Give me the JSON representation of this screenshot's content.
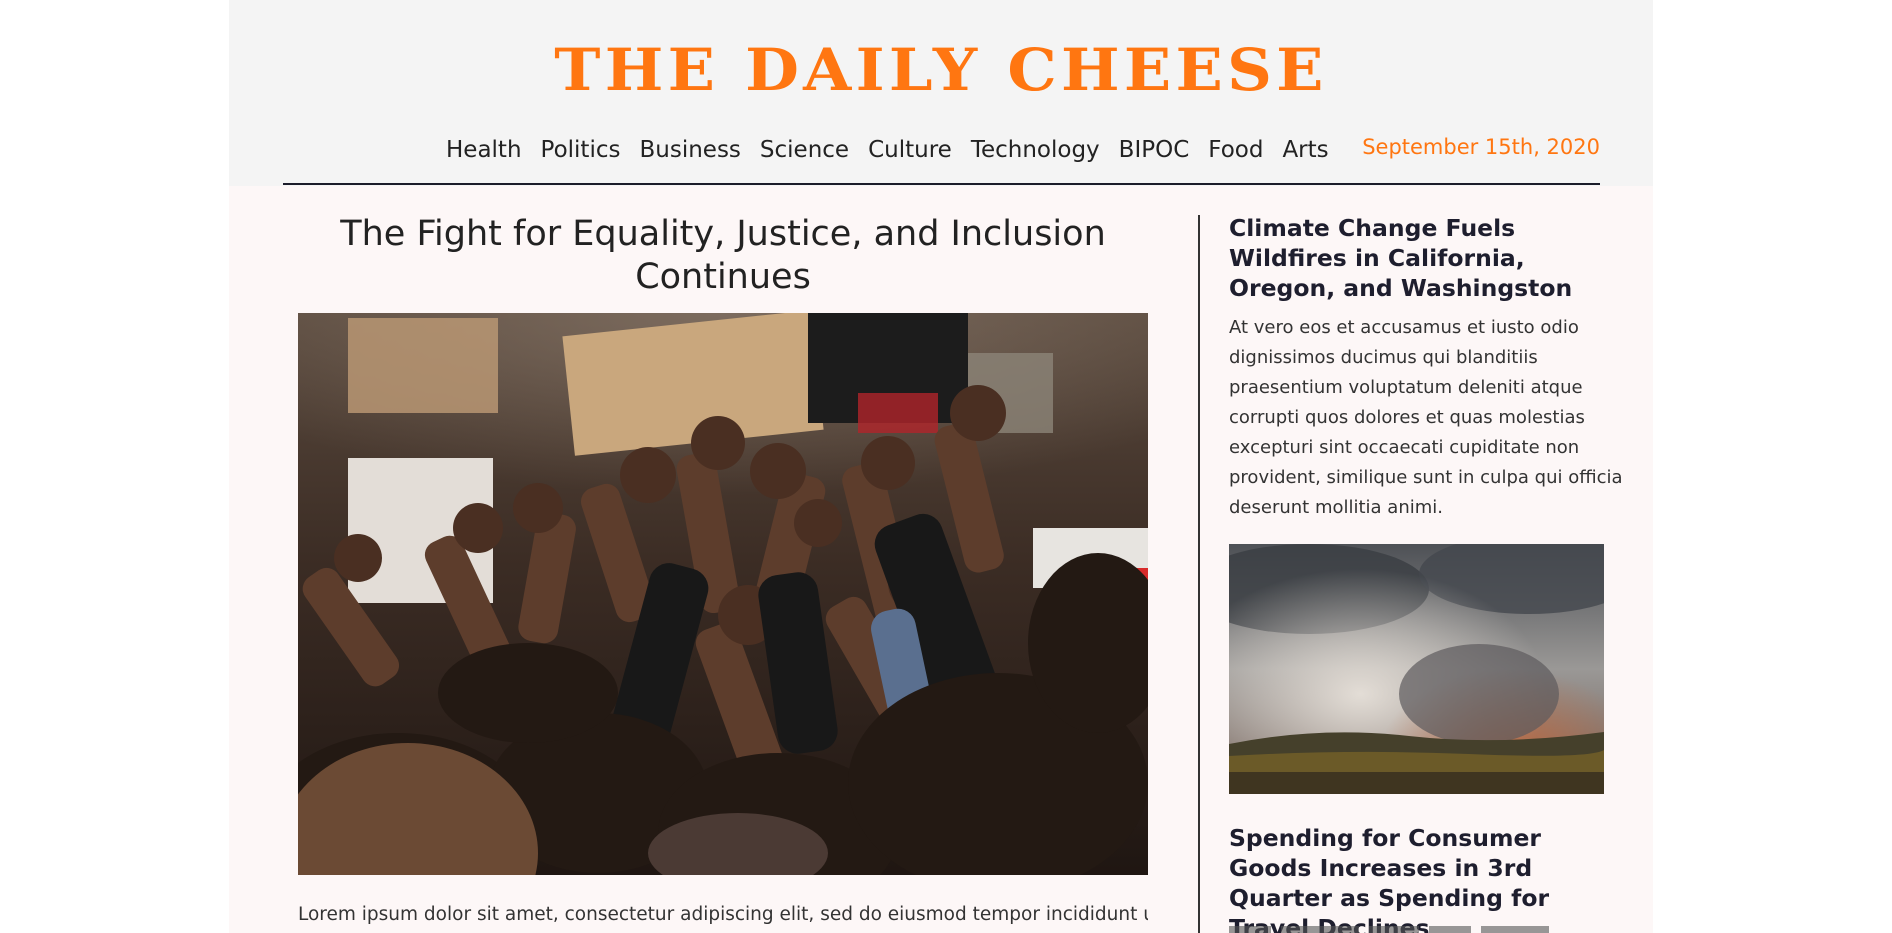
{
  "masthead": {
    "title": "THE DAILY CHEESE",
    "date": "September 15th, 2020"
  },
  "nav": {
    "items": [
      {
        "label": "Health"
      },
      {
        "label": "Politics"
      },
      {
        "label": "Business"
      },
      {
        "label": "Science"
      },
      {
        "label": "Culture"
      },
      {
        "label": "Technology"
      },
      {
        "label": "BIPOC"
      },
      {
        "label": "Food"
      },
      {
        "label": "Arts"
      }
    ]
  },
  "main_article": {
    "title": "The Fight for Equality, Justice, and Inclusion Continues",
    "lede": "Lorem ipsum dolor sit amet, consectetur adipiscing elit, sed do eiusmod tempor incididunt ut"
  },
  "sidebar": {
    "articles": [
      {
        "title": "Climate Change Fuels Wildfires in California, Oregon, and Washingston",
        "body": "At vero eos et accusamus et iusto odio dignissimos ducimus qui blanditiis praesentium voluptatum deleniti atque corrupti quos dolores et quas molestias excepturi sint occaecati cupiditate non provident, similique sunt in culpa qui officia deserunt mollitia animi."
      },
      {
        "title": "Spending for Consumer Goods Increases in 3rd Quarter as Spending for Travel Declines"
      }
    ]
  },
  "colors": {
    "brand": "#ff7611",
    "page_background": "#fdf7f7",
    "header_background": "#f4f4f4",
    "rule": "#1c1c2a"
  },
  "images": {
    "hero": "protest-crowd-raised-fists-photo",
    "sidebar": "wildfire-smoke-landscape-photo"
  }
}
